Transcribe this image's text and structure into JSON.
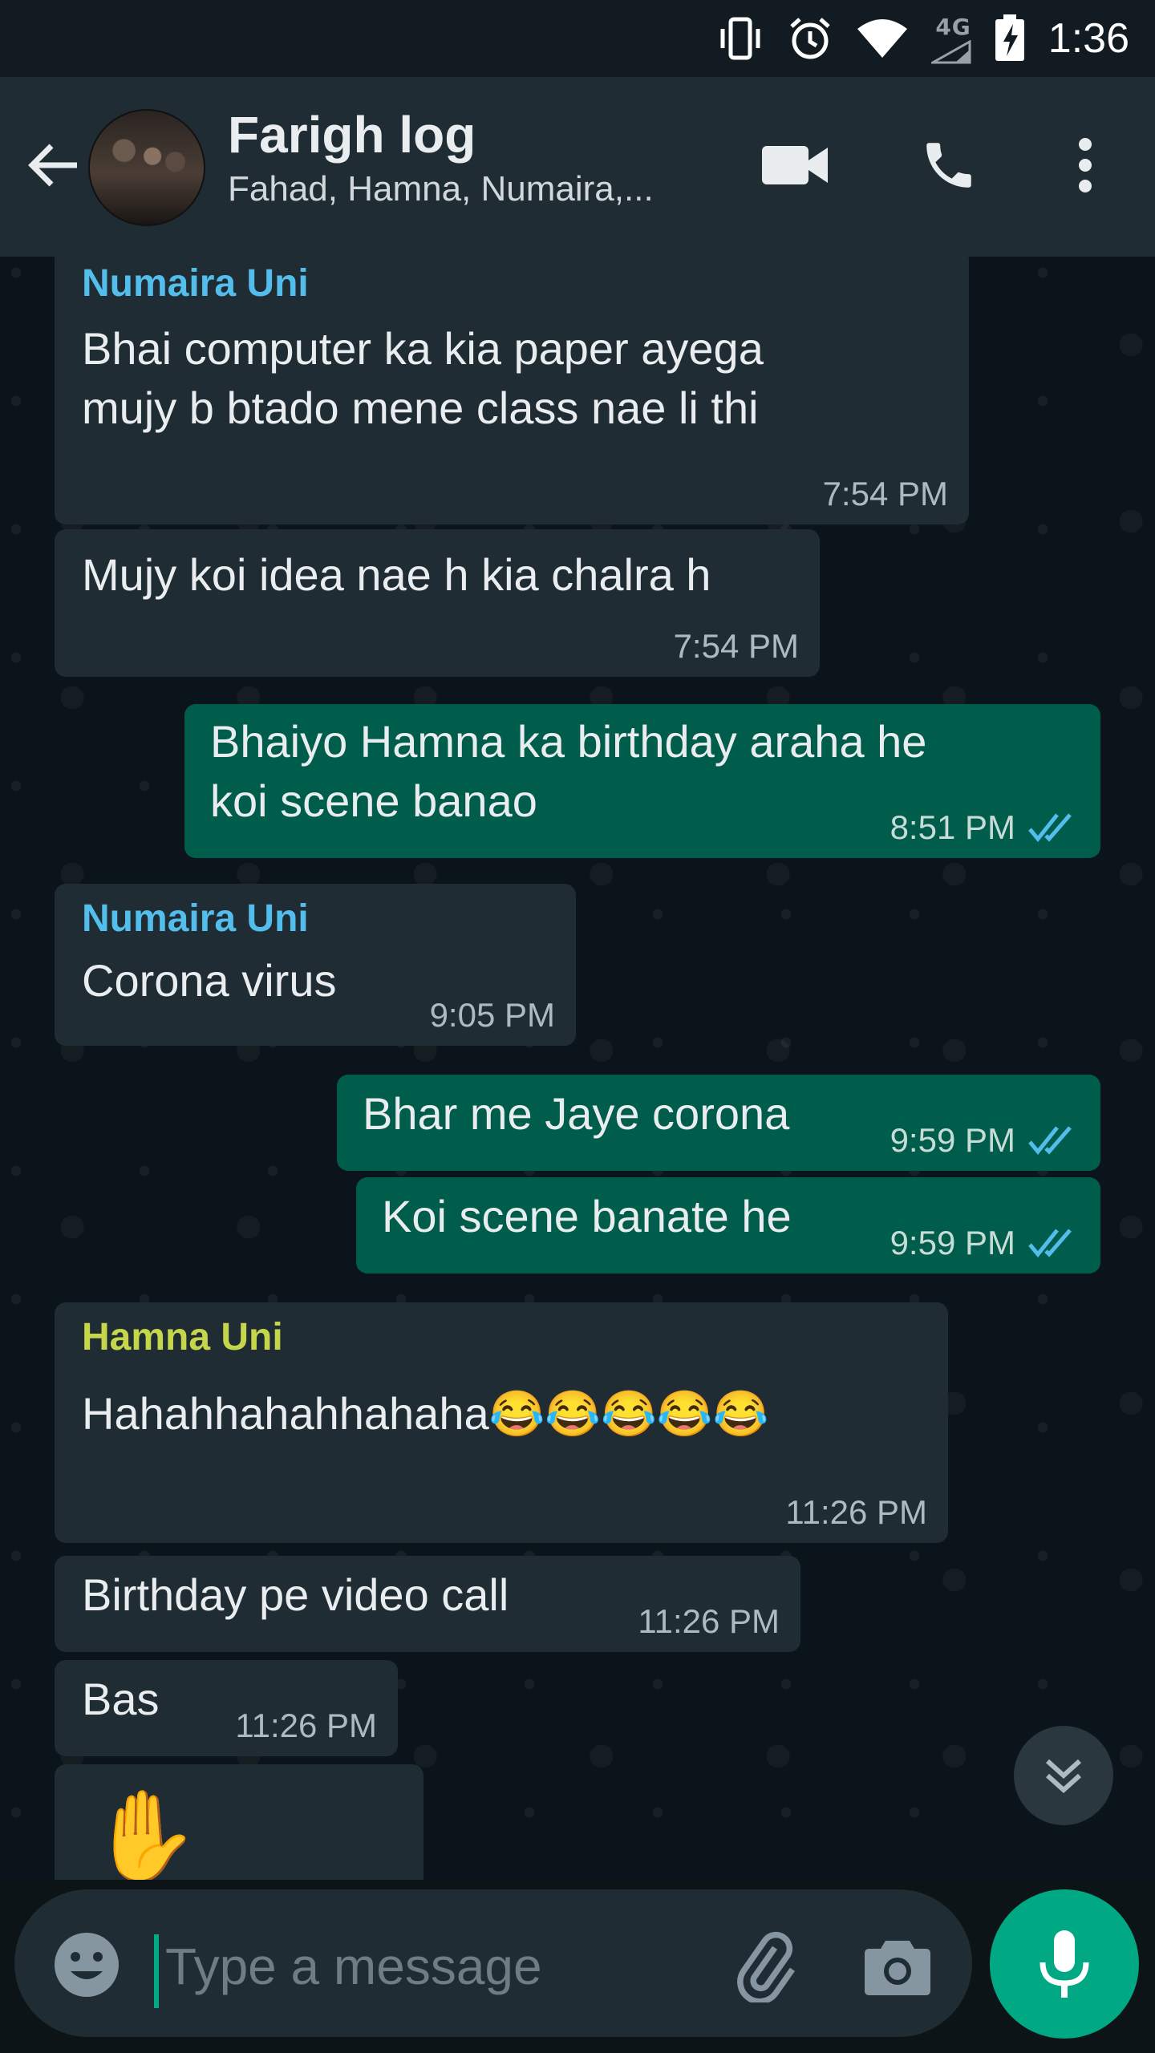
{
  "status_bar": {
    "network": "4G",
    "time": "1:36",
    "icons": [
      "vibrate-icon",
      "alarm-icon",
      "wifi-icon",
      "signal-icon",
      "battery-charging-icon"
    ]
  },
  "header": {
    "title": "Farigh log",
    "subtitle": "Fahad, Hamna, Numaira,...",
    "icons": [
      "back-arrow-icon",
      "video-call-icon",
      "voice-call-icon",
      "more-options-icon"
    ]
  },
  "messages": [
    {
      "direction": "in",
      "sender": "Numaira Uni",
      "text_lines": [
        "Bhai computer ka kia paper ayega",
        "mujy b btado mene class nae li thi"
      ],
      "time": "7:54 PM"
    },
    {
      "direction": "in",
      "sender": "",
      "text_lines": [
        "Mujy koi idea nae h kia chalra h"
      ],
      "time": "7:54 PM"
    },
    {
      "direction": "out",
      "text_lines": [
        "Bhaiyo Hamna ka birthday araha he",
        "koi scene banao"
      ],
      "time": "8:51 PM",
      "status": "read"
    },
    {
      "direction": "in",
      "sender": "Numaira Uni",
      "text_lines": [
        "Corona virus"
      ],
      "time": "9:05 PM"
    },
    {
      "direction": "out",
      "text_lines": [
        "Bhar me Jaye corona"
      ],
      "time": "9:59 PM",
      "status": "read"
    },
    {
      "direction": "out",
      "text_lines": [
        "Koi scene banate he"
      ],
      "time": "9:59 PM",
      "status": "read"
    },
    {
      "direction": "in",
      "sender": "Hamna Uni",
      "text_lines": [
        "Hahahhahahhahaha😂😂😂😂😂"
      ],
      "time": "11:26 PM"
    },
    {
      "direction": "in",
      "sender": "",
      "text_lines": [
        "Birthday pe video call"
      ],
      "time": "11:26 PM"
    },
    {
      "direction": "in",
      "sender": "",
      "text_lines": [
        "Bas"
      ],
      "time": "11:26 PM"
    },
    {
      "direction": "in",
      "sender": "",
      "text_lines": [
        "✋"
      ],
      "time": ""
    }
  ],
  "sender_colors": {
    "Numaira Uni": "#53bdeb",
    "Hamna Uni": "#c6d64a"
  },
  "composer": {
    "placeholder": "Type a message",
    "icons": [
      "emoji-icon",
      "attach-icon",
      "camera-icon",
      "mic-icon"
    ]
  },
  "colors": {
    "accent": "#00a884",
    "incoming_bubble": "#202c33",
    "outgoing_bubble": "#005c4b",
    "read_tick": "#53bdeb",
    "header": "#202c33"
  }
}
